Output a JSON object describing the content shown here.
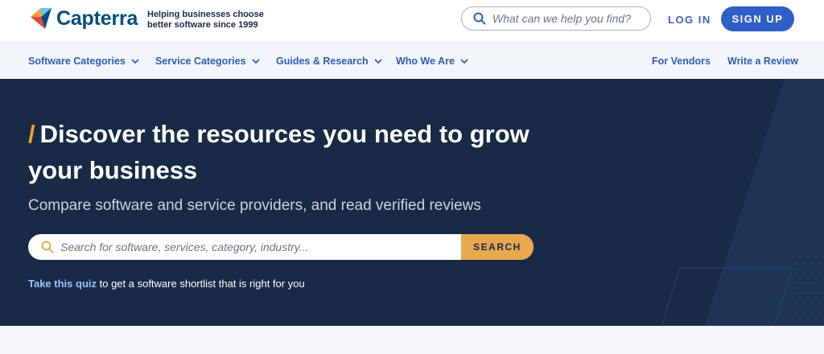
{
  "brand": {
    "name": "Capterra",
    "tagline_line1": "Helping businesses choose",
    "tagline_line2": "better software since 1999"
  },
  "header": {
    "search_placeholder": "What can we help you find?",
    "login_label": "LOG IN",
    "signup_label": "SIGN UP"
  },
  "nav": {
    "items": [
      {
        "label": "Software Categories",
        "icon": "chevron-down-icon"
      },
      {
        "label": "Service Categories",
        "icon": "chevron-down-icon"
      },
      {
        "label": "Guides & Research",
        "icon": "chevron-down-icon"
      },
      {
        "label": "Who We Are",
        "icon": "chevron-down-icon"
      }
    ],
    "right": {
      "vendors": "For Vendors",
      "review": "Write a Review"
    }
  },
  "hero": {
    "slash": "/",
    "title": "Discover the resources you need to grow your business",
    "subtitle": "Compare software and service providers, and read verified reviews",
    "search_placeholder": "Search for software, services, category, industry...",
    "search_button": "SEARCH",
    "quiz_link": "Take this quiz",
    "quiz_text": " to get a software shortlist that is right for you"
  },
  "colors": {
    "brand_blue": "#044D80",
    "primary": "#2F5FC7",
    "hero_bg": "#192A47",
    "accent_orange": "#E8A84E",
    "nav_bg": "#F2F6FA"
  }
}
